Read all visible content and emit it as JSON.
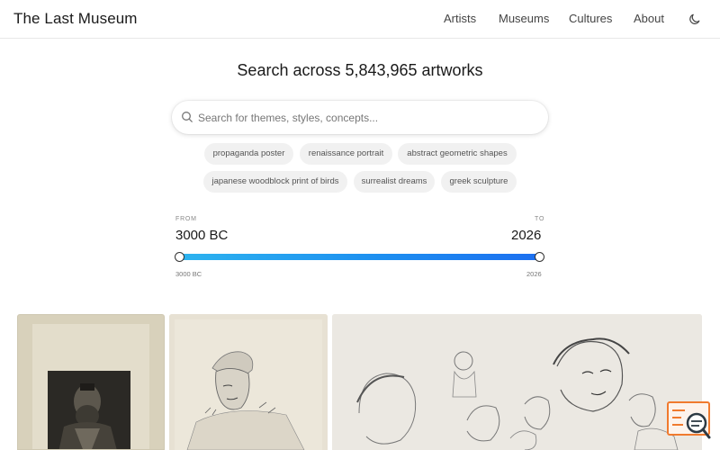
{
  "header": {
    "brand": "The Last Museum",
    "nav": [
      {
        "label": "Artists"
      },
      {
        "label": "Museums"
      },
      {
        "label": "Cultures"
      },
      {
        "label": "About"
      }
    ],
    "theme_icon": "moon-icon"
  },
  "hero": {
    "title": "Search across 5,843,965 artworks"
  },
  "search": {
    "placeholder": "Search for themes, styles, concepts...",
    "value": "",
    "icon": "search-icon"
  },
  "suggestions": [
    {
      "label": "propaganda poster"
    },
    {
      "label": "renaissance portrait"
    },
    {
      "label": "abstract geometric shapes"
    },
    {
      "label": "japanese woodblock print of birds"
    },
    {
      "label": "surrealist dreams"
    },
    {
      "label": "greek sculpture"
    }
  ],
  "range": {
    "from_label": "FROM",
    "to_label": "TO",
    "from_value": "3000 BC",
    "to_value": "2026",
    "min_label": "3000 BC",
    "max_label": "2026",
    "accent_start": "#2db3ef",
    "accent_end": "#1c6ff0"
  },
  "gallery": [
    {
      "kind": "engraved-portrait"
    },
    {
      "kind": "sketch-sleeping-figure"
    },
    {
      "kind": "sketch-study-heads"
    }
  ],
  "widget": {
    "icon": "chat-search-icon",
    "accent": "#f07a2e"
  }
}
